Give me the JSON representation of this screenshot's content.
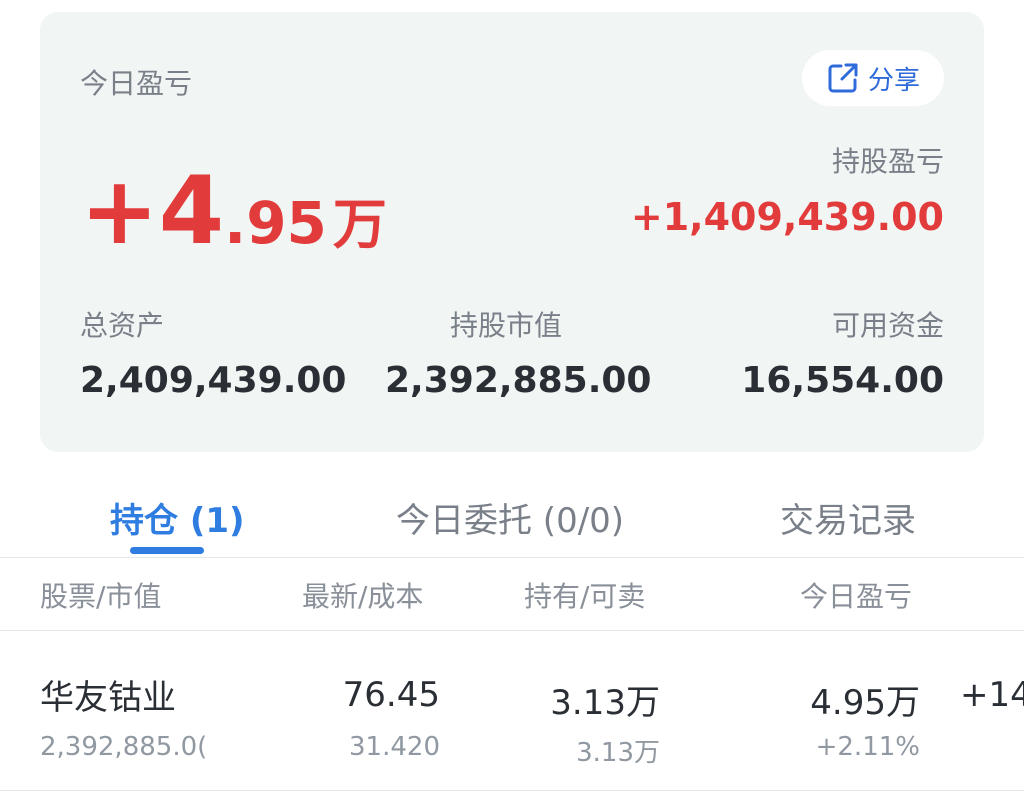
{
  "summary": {
    "today_pl_label": "今日盈亏",
    "today_pl_sign_int": "+4",
    "today_pl_dec": ".95",
    "today_pl_unit": "万",
    "share_label": "分享",
    "holding_pl_label": "持股盈亏",
    "holding_pl_value": "+1,409,439.00",
    "total_assets_label": "总资产",
    "total_assets_value": "2,409,439.00",
    "market_value_label": "持股市值",
    "market_value_value": "2,392,885.00",
    "available_cash_label": "可用资金",
    "available_cash_value": "16,554.00"
  },
  "tabs": [
    {
      "label": "持仓 (1)",
      "active": true
    },
    {
      "label": "今日委托 (0/0)",
      "active": false
    },
    {
      "label": "交易记录",
      "active": false
    }
  ],
  "table": {
    "headers": [
      "股票/市值",
      "最新/成本",
      "持有/可卖",
      "今日盈亏"
    ],
    "rows": [
      {
        "name": "华友钴业",
        "market_value": "2,392,885.0(",
        "latest": "76.45",
        "cost": "31.420",
        "holding": "3.13万",
        "sellable": "3.13万",
        "today_pl": "4.95万",
        "today_pl_pct": "+2.11%",
        "extra": "+14"
      }
    ]
  },
  "colors": {
    "accent": "#2f7de1",
    "profit": "#e23b3b",
    "card_bg": "#f1f5f3"
  }
}
